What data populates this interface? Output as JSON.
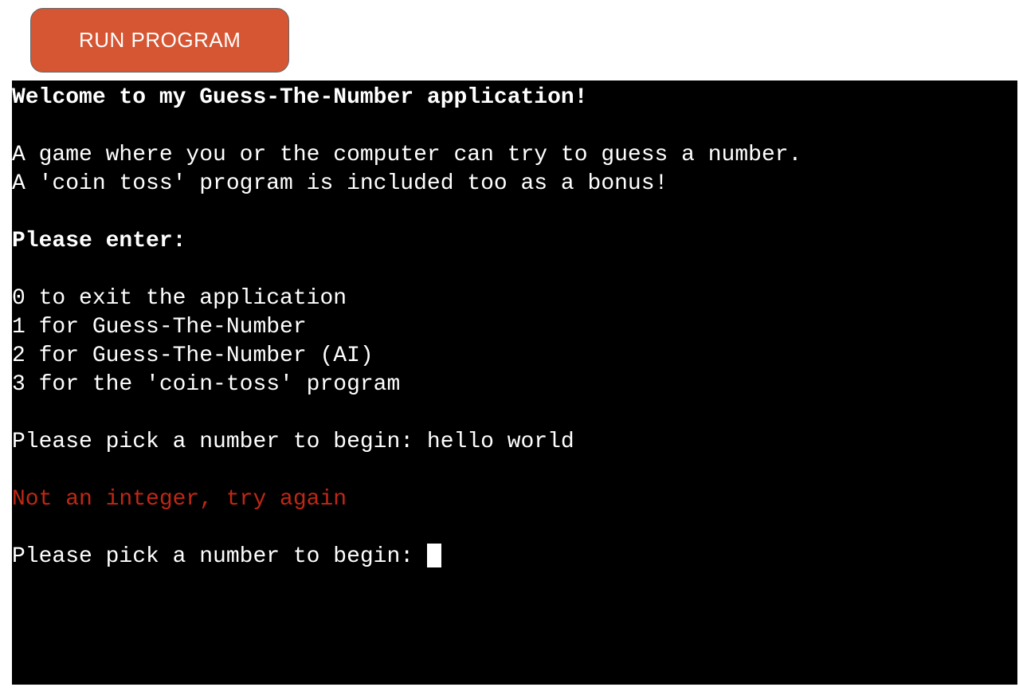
{
  "toolbar": {
    "run_label": "RUN PROGRAM"
  },
  "terminal": {
    "welcome_title": "Welcome to my Guess-The-Number application!",
    "description_line1": "A game where you or the computer can try to guess a number.",
    "description_line2": "A 'coin toss' program is included too as a bonus!",
    "menu_header": "Please enter:",
    "menu_option_0": "0 to exit the application",
    "menu_option_1": "1 for Guess-The-Number",
    "menu_option_2": "2 for Guess-The-Number (AI)",
    "menu_option_3": "3 for the 'coin-toss' program",
    "prompt_text": "Please pick a number to begin: ",
    "user_input": "hello world",
    "error_message": "Not an integer, try again",
    "prompt_text_2": "Please pick a number to begin: "
  },
  "colors": {
    "button_bg": "#d65532",
    "terminal_bg": "#000000",
    "terminal_fg": "#ffffff",
    "error_fg": "#c02715"
  }
}
